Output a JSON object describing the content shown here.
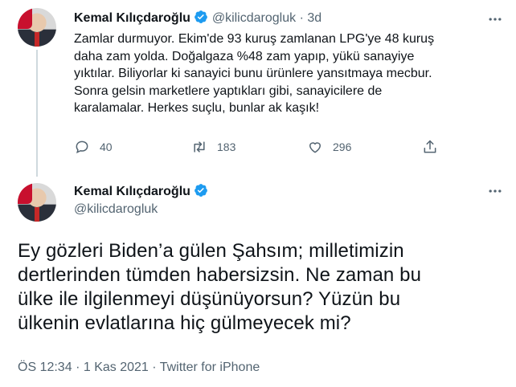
{
  "tweet1": {
    "name": "Kemal Kılıçdaroğlu",
    "handle": "@kilicdarogluk",
    "separator": "·",
    "time": "3d",
    "lines": [
      "Zamlar durmuyor. Ekim'de 93 kuruş zamlanan LPG'ye 48 kuruş",
      "daha zam yolda. Doğalgaza %48 zam yapıp, yükü sanayiye",
      "yıktılar. Biliyorlar ki sanayici bunu ürünlere yansıtmaya mecbur.",
      "Sonra gelsin marketlere yaptıkları gibi, sanayicilere de",
      "karalamalar. Herkes suçlu, bunlar ak kaşık!"
    ],
    "replies": "40",
    "retweets": "183",
    "likes": "296"
  },
  "tweet2": {
    "name": "Kemal Kılıçdaroğlu",
    "handle": "@kilicdarogluk",
    "lines": [
      "Ey gözleri Biden’a gülen Şahsım; milletimizin",
      "dertlerinden tümden habersizsin. Ne zaman bu",
      "ülke ile ilgilenmeyi düşünüyorsun? Yüzün bu",
      "ülkenin evlatlarına hiç gülmeyecek mi?"
    ],
    "time": "ÖS 12:34",
    "date": "1 Kas 2021",
    "source": "Twitter for iPhone",
    "dot": "·"
  },
  "colors": {
    "verified": "#1d9bf0",
    "secondary": "#536471",
    "thread": "#cfd9de"
  }
}
